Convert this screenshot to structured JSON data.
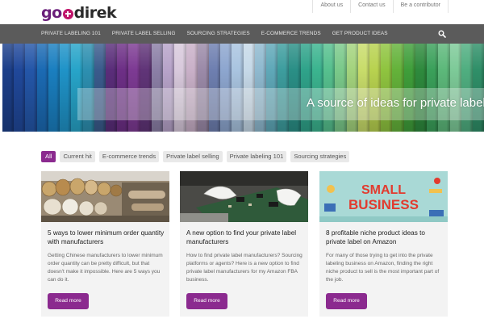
{
  "brand": {
    "logo_prefix": "go",
    "logo_suffix": "direk",
    "accent_color": "#8b2a8f"
  },
  "top_links": [
    "About us",
    "Contact us",
    "Be a contributor"
  ],
  "nav": {
    "items": [
      "PRIVATE LABELING 101",
      "PRIVATE LABEL SELLING",
      "SOURCING STRATEGIES",
      "E-COMMERCE TRENDS",
      "GET PRODUCT IDEAS"
    ],
    "search_icon": "search-icon"
  },
  "hero": {
    "title": "A source of ideas for private label"
  },
  "filters": [
    "All",
    "Current hit",
    "E-commerce trends",
    "Private label selling",
    "Private labeling 101",
    "Sourcing strategies"
  ],
  "cards": [
    {
      "title": "5 ways to lower minimum order quantity with manufacturers",
      "excerpt": "Getting Chinese manufacturers to lower minimum order quantity can be pretty difficult, but that doesn't make it impossible. Here are 5 ways you can do it.",
      "button": "Read more"
    },
    {
      "title": "A new option to find your private label manufacturers",
      "excerpt": "How to find private label manufacturers? Sourcing platforms or agents? Here is a new option to find private label manufacturers for my Amazon FBA business.",
      "button": "Read more"
    },
    {
      "title": "8 profitable niche product ideas to private label on Amazon",
      "excerpt": "For many of those trying to get into the private labeling business on Amazon, finding the right niche product to sell is the most important part of the job.",
      "button": "Read more",
      "image_text": [
        "SMALL",
        "BUSINESS"
      ]
    }
  ]
}
